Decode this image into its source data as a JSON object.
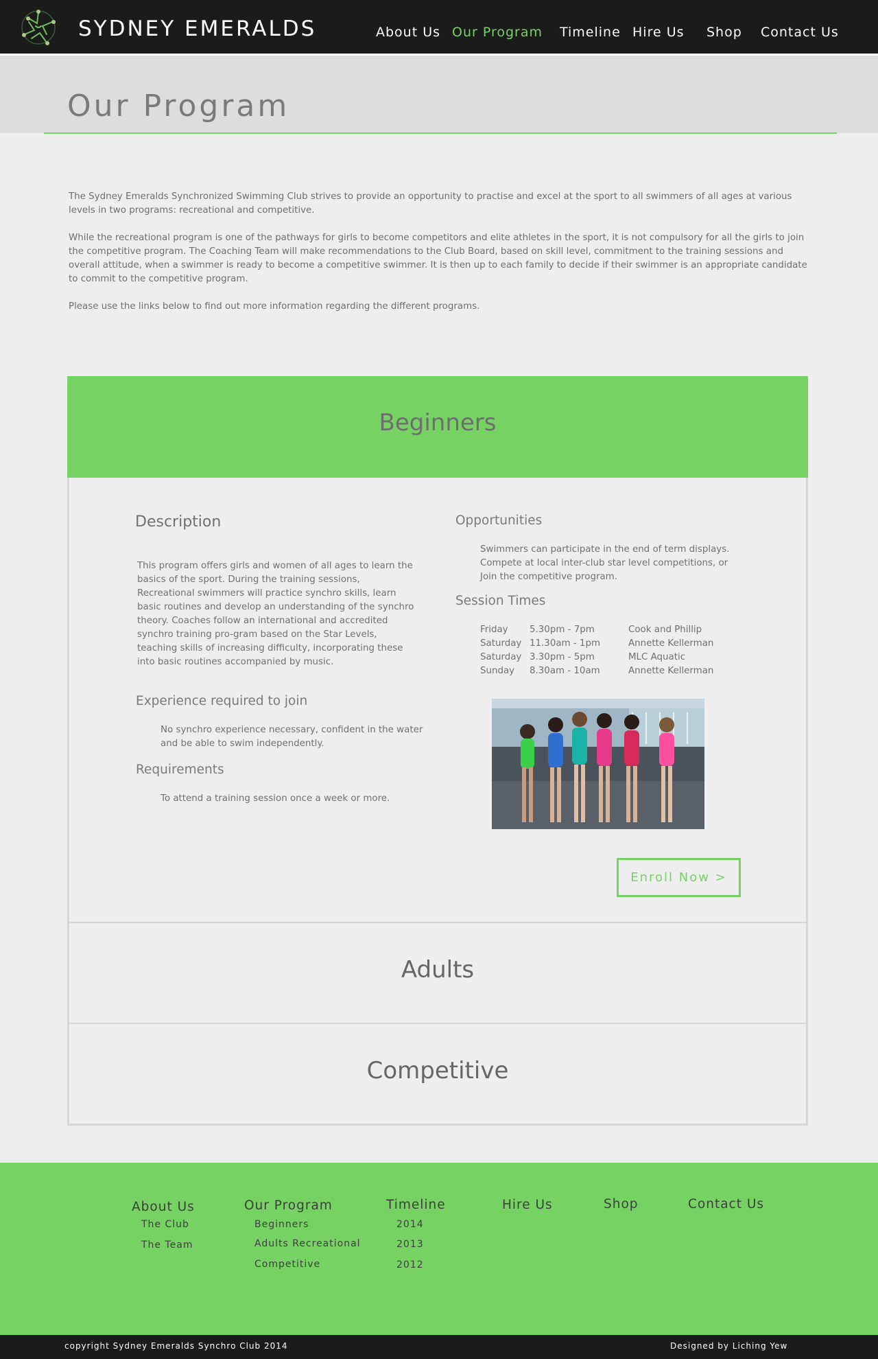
{
  "header": {
    "site_title": "SYDNEY EMERALDS",
    "nav": [
      {
        "label": "About Us",
        "active": false
      },
      {
        "label": "Our Program",
        "active": true
      },
      {
        "label": "Timeline",
        "active": false
      },
      {
        "label": "Hire Us",
        "active": false
      },
      {
        "label": "Shop",
        "active": false
      },
      {
        "label": "Contact Us",
        "active": false
      }
    ]
  },
  "page_title": "Our Program",
  "intro": [
    "The Sydney Emeralds Synchronized Swimming Club strives to provide an opportunity to practise and excel at the sport to all swimmers of all ages at various levels in two programs: recreational and competitive.",
    "While the recreational program is one of the pathways for girls to become competitors and elite athletes in the sport, it is not compulsory for all the girls to join the competitive program. The Coaching Team will make recommendations to the Club Board, based on skill level, commitment to the training sessions and overall attitude, when a swimmer is ready to become a competitive swimmer. It is then up to each family to decide if their swimmer is an appropriate candidate to commit to the competitive program.",
    "Please use the links below to find out more information regarding the different programs."
  ],
  "beginners": {
    "title": "Beginners",
    "description_heading": "Description",
    "description": "This program offers girls and women of all ages to learn the basics of the sport. During the training sessions, Recreational swimmers will practice synchro skills, learn basic routines and develop an understanding of the synchro theory. Coaches follow an international and accredited synchro training pro-gram based on the Star Levels, teaching skills of increasing difficulty, incorporating these into basic routines accompanied by music.",
    "experience_heading": "Experience required to join",
    "experience": "No synchro experience necessary, confident in the water and be able to swim independently.",
    "requirements_heading": "Requirements",
    "requirements": "To attend a training session once a week or more.",
    "opportunities_heading": "Opportunities",
    "opportunities": "Swimmers can participate in the end of term displays. Compete at local inter-club star level competitions, or Join the competitive program.",
    "sessions_heading": "Session Times",
    "sessions": [
      {
        "day": "Friday",
        "time": "5.30pm - 7pm",
        "venue": "Cook and Phillip"
      },
      {
        "day": "Saturday",
        "time": "11.30am - 1pm",
        "venue": "Annette Kellerman"
      },
      {
        "day": "Saturday",
        "time": "3.30pm - 5pm",
        "venue": "MLC Aquatic"
      },
      {
        "day": "Sunday",
        "time": "8.30am - 10am",
        "venue": "Annette Kellerman"
      }
    ],
    "enroll_label": "Enroll Now >"
  },
  "sections": {
    "adults": "Adults",
    "competitive": "Competitive"
  },
  "footer": {
    "about": {
      "heading": "About Us",
      "items": [
        "The Club",
        "The Team"
      ]
    },
    "program": {
      "heading": "Our Program",
      "items": [
        "Beginners",
        "Adults Recreational",
        "Competitive"
      ]
    },
    "timeline": {
      "heading": "Timeline",
      "items": [
        "2014",
        "2013",
        "2012"
      ]
    },
    "hire": {
      "heading": "Hire Us"
    },
    "shop": {
      "heading": "Shop"
    },
    "contact": {
      "heading": "Contact Us"
    },
    "copyright": "copyright  Sydney Emeralds Synchro Club 2014",
    "designer": "Designed by Liching Yew"
  },
  "colors": {
    "accent": "#77d264",
    "header_bg": "#1b1b1b",
    "page_bg": "#eeeeee",
    "title_band": "#dddddd"
  }
}
